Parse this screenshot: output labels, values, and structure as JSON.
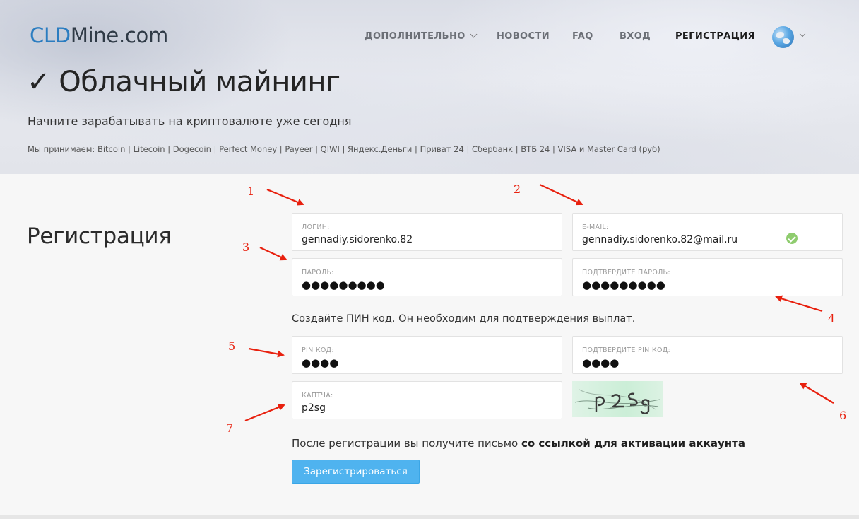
{
  "brand": {
    "logo_part1": "CLD",
    "logo_part2": "Mine.com"
  },
  "nav": {
    "more": "ДОПОЛНИТЕЛЬНО",
    "news": "НОВОСТИ",
    "faq": "FAQ",
    "login": "ВХОД",
    "register": "РЕГИСТРАЦИЯ"
  },
  "hero": {
    "title": "✓ Облачный майнинг",
    "subtitle": "Начните зарабатывать на криптовалюте уже сегодня",
    "accept": "Мы принимаем: Bitcoin | Litecoin | Dogecoin | Perfect Money | Payeer | QIWI | Яндекс.Деньги | Приват 24 | Сбербанк | ВТБ 24 | VISA и Master Card (руб)"
  },
  "form": {
    "heading": "Регистрация",
    "login": {
      "label": "ЛОГИН:",
      "value": "gennadiy.sidorenko.82"
    },
    "email": {
      "label": "E-MAIL:",
      "value": "gennadiy.sidorenko.82@mail.ru"
    },
    "password": {
      "label": "ПАРОЛЬ:",
      "value": "●●●●●●●●●"
    },
    "password_confirm": {
      "label": "ПОДТВЕРДИТЕ ПАРОЛЬ:",
      "value": "●●●●●●●●●"
    },
    "pin_note": "Создайте ПИН код. Он необходим для подтверждения выплат.",
    "pin": {
      "label": "PIN КОД:",
      "value": "●●●●"
    },
    "pin_confirm": {
      "label": "ПОДТВЕРДИТЕ PIN КОД:",
      "value": "●●●●"
    },
    "captcha": {
      "label": "КАПТЧА:",
      "value": "p2sg"
    },
    "after_note_plain": "После регистрации вы получите письмо ",
    "after_note_bold": "со ссылкой для активации аккаунта",
    "submit": "Зарегистрироваться"
  },
  "annotations": {
    "n1": "1",
    "n2": "2",
    "n3": "3",
    "n4": "4",
    "n5": "5",
    "n6": "6",
    "n7": "7",
    "color": "#e8200e"
  },
  "colors": {
    "logo_accent": "#2a7cc0",
    "button": "#4fb3ef",
    "valid_check": "#8fcc6f"
  }
}
